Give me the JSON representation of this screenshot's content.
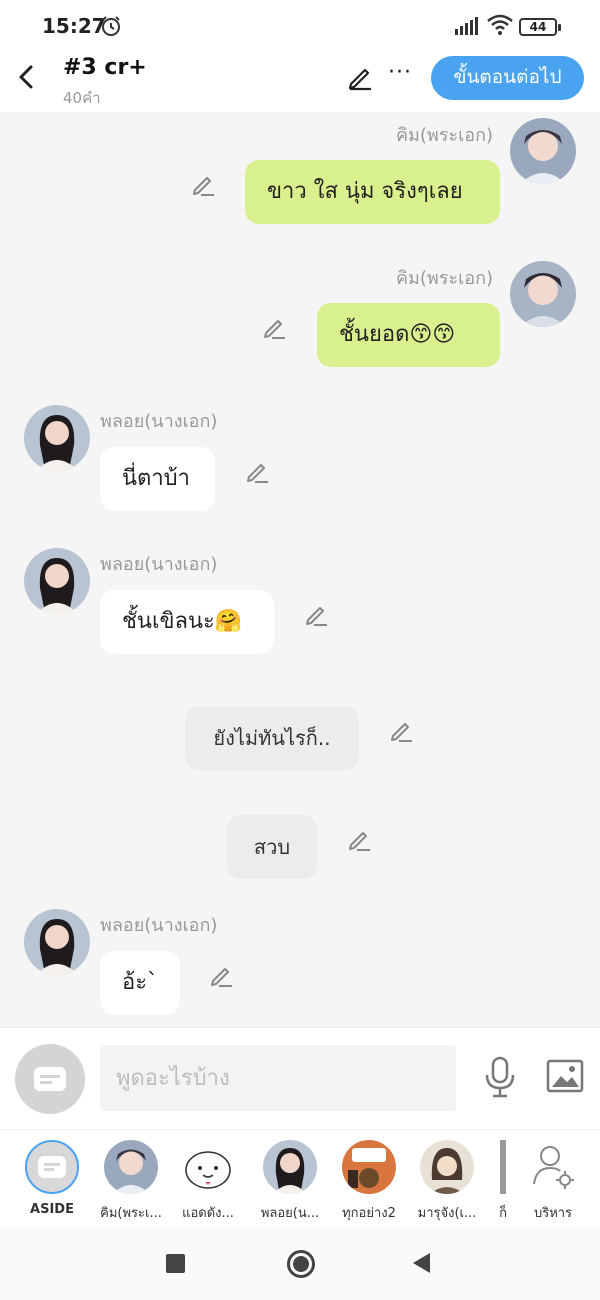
{
  "status": {
    "time": "15:27",
    "battery": "44"
  },
  "header": {
    "title": "#3 cr+",
    "word_count": "40คำ",
    "next_label": "ขั้นตอนต่อไป"
  },
  "messages": [
    {
      "speaker": "คิม(พระเอก)",
      "text": "ขาว ใส นุ่ม  จริงๆเลย",
      "side": "right"
    },
    {
      "speaker": "คิม(พระเอก)",
      "text": "ชั้นยอด😙😙",
      "side": "right"
    },
    {
      "speaker": "พลอย(นางเอก)",
      "text": "นี่ตาบ้า",
      "side": "left"
    },
    {
      "speaker": "พลอย(นางเอก)",
      "text": "ชั้นเขิลนะ🤗",
      "side": "left"
    },
    {
      "speaker": "",
      "text": "ยังไม่ทันไรก็..",
      "side": "aside"
    },
    {
      "speaker": "",
      "text": "สวบ",
      "side": "aside"
    },
    {
      "speaker": "พลอย(นางเอก)",
      "text": "อ้ะ`",
      "side": "left"
    }
  ],
  "input": {
    "placeholder": "พูดอะไรบ้าง"
  },
  "characters": [
    {
      "label": "ASIDE"
    },
    {
      "label": "คิม(พระเ..."
    },
    {
      "label": "แอดดัง..."
    },
    {
      "label": "พลอย(น..."
    },
    {
      "label": "ทุกอย่าง2"
    },
    {
      "label": "มารุจัง(เ..."
    },
    {
      "label": "ก็"
    },
    {
      "label": "บริหาร"
    }
  ],
  "colors": {
    "accent": "#4aa3f0",
    "green_bubble": "#d9f08f",
    "white_bubble": "#ffffff",
    "aside_bubble": "#ececec"
  }
}
